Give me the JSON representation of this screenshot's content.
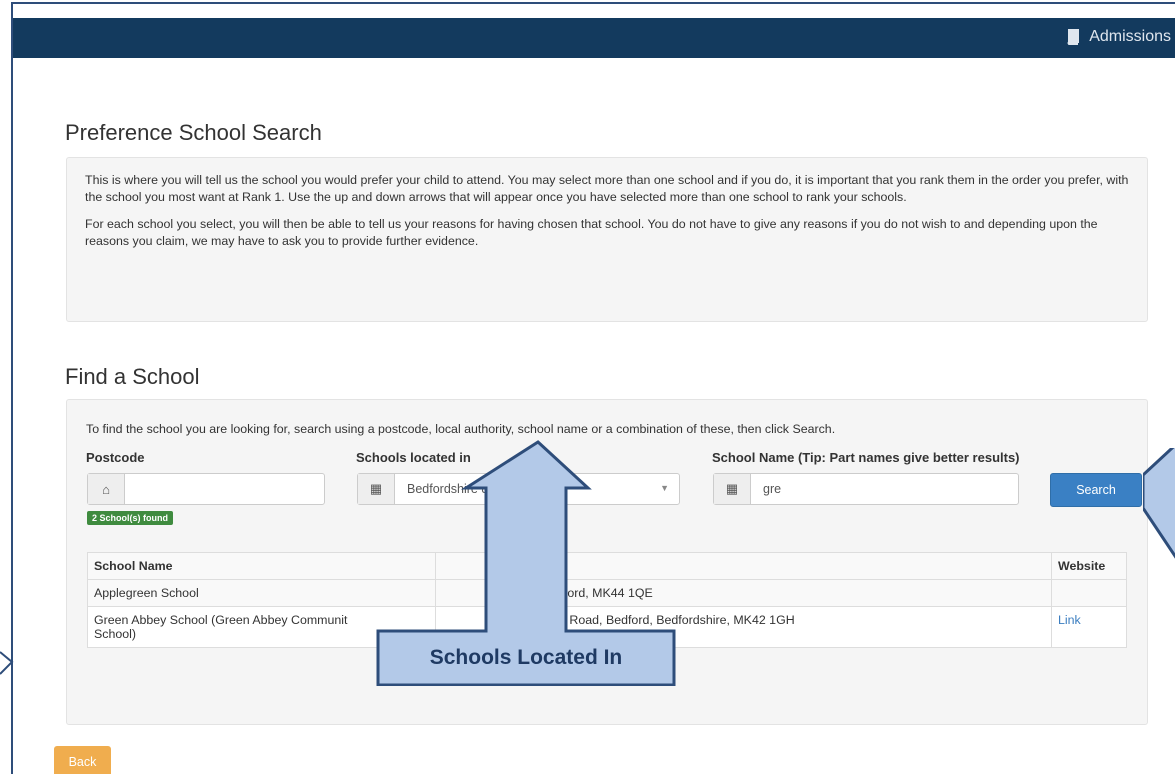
{
  "header": {
    "brand_label": "Admissions",
    "brand_icon": "book-icon"
  },
  "intro": {
    "title": "Preference School Search",
    "paragraphs": [
      "This is where you will tell us the school you would prefer your child to attend. You may select more than one school and if you do, it is important that you rank them in the order you prefer, with the school you most want at Rank 1. Use the up and down arrows that will appear once you have selected more than one school to rank your schools.",
      "For each school you select, you will then be able to tell us your reasons for having chosen that school. You do not have to give any reasons if you do not wish to and depending upon the reasons you claim, we may have to ask you to provide further evidence."
    ]
  },
  "find": {
    "title": "Find a School",
    "hint": "To find the school you are looking for, search using a postcode, local authority, school name or a combination of these, then click Search.",
    "postcode_label": "Postcode",
    "postcode_value": "",
    "located_label": "Schools located in",
    "located_value": "Bedfordshire 820",
    "name_label": "School Name (Tip: Part names give better results)",
    "name_value": "gre",
    "search_label": "Search",
    "found_badge": "2 School(s) found"
  },
  "results": {
    "headers": [
      "School Name",
      "",
      "",
      "Website"
    ],
    "rows": [
      {
        "name": "Applegreen School",
        "address": ", Bedford, MK44 1QE",
        "website": ""
      },
      {
        "name": "Green Abbey School (Green Abbey Communit",
        "name2": "School)",
        "address": "rnaby Road, Bedford, Bedfordshire, MK42 1GH",
        "website": "Link"
      }
    ]
  },
  "back_label": "Back",
  "callout": {
    "text": "Schools Located In",
    "fill": "#b3c9e8",
    "stroke": "#2e4d7a"
  },
  "colors": {
    "navbar": "#133a5e",
    "search_button": "#3a80c4",
    "back_button": "#f0ad4e",
    "badge": "#3f8b3f"
  }
}
